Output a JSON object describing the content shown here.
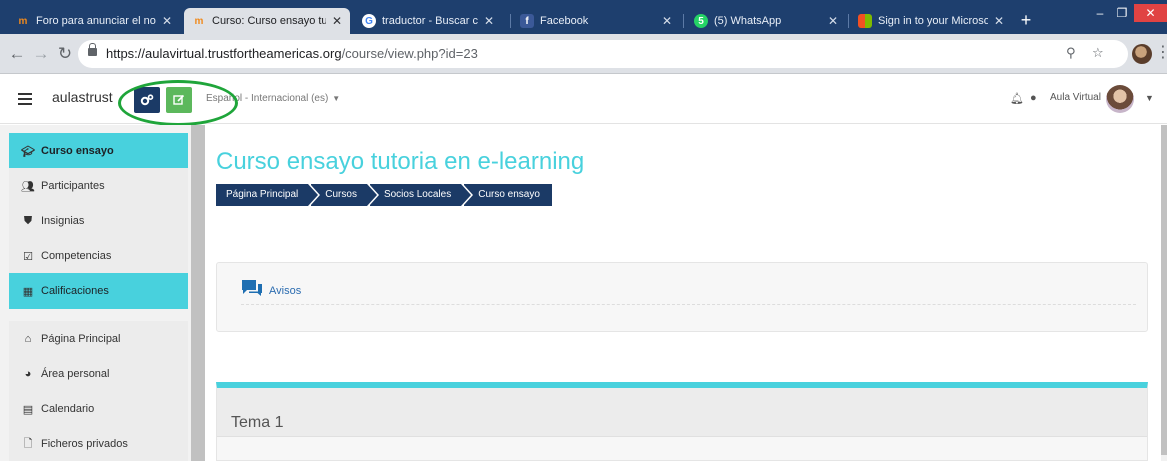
{
  "browser": {
    "tabs": [
      {
        "title": "Foro para anunciar el no",
        "favicon": "moodle-hat-icon",
        "active": false
      },
      {
        "title": "Curso: Curso ensayo tuto",
        "favicon": "moodle-hat-icon",
        "active": true
      },
      {
        "title": "traductor - Buscar con G",
        "favicon": "google-icon",
        "active": false
      },
      {
        "title": "Facebook",
        "favicon": "facebook-icon",
        "active": false
      },
      {
        "title": "(5) WhatsApp",
        "favicon": "whatsapp-icon",
        "active": false
      },
      {
        "title": "Sign in to your Microsof",
        "favicon": "microsoft-icon",
        "active": false
      }
    ],
    "url_host": "https://aulavirtual.trustfortheamericas.org",
    "url_path": "/course/view.php?id=23"
  },
  "navbar": {
    "site_name": "aulastrust",
    "language": "Español - Internacional (es)",
    "user_name": "Aula Virtual"
  },
  "drawer": {
    "items": [
      {
        "label": "Curso ensayo",
        "icon": "graduation-cap-icon"
      },
      {
        "label": "Participantes",
        "icon": "users-icon"
      },
      {
        "label": "Insignias",
        "icon": "shield-icon"
      },
      {
        "label": "Competencias",
        "icon": "check-square-icon"
      },
      {
        "label": "Calificaciones",
        "icon": "table-icon"
      },
      {
        "label": "Página Principal",
        "icon": "home-icon"
      },
      {
        "label": "Área personal",
        "icon": "tachometer-icon"
      },
      {
        "label": "Calendario",
        "icon": "calendar-icon"
      },
      {
        "label": "Ficheros privados",
        "icon": "file-icon"
      }
    ]
  },
  "main": {
    "title": "Curso ensayo tutoria en e-learning",
    "breadcrumb": [
      "Página Principal",
      "Cursos",
      "Socios Locales",
      "Curso ensayo"
    ],
    "forum_label": "Avisos",
    "section_title": "Tema 1"
  },
  "colors": {
    "accent": "#48d1dd",
    "breadcrumb": "#1b3a66",
    "tabstrip": "#1e3f6e",
    "highlight_ring": "#1fa53a"
  }
}
